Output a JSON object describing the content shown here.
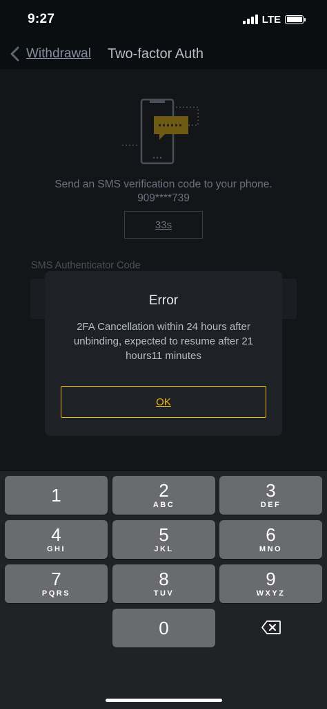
{
  "status_bar": {
    "time": "9:27",
    "network": "LTE"
  },
  "nav": {
    "back_label": "Withdrawal",
    "title": "Two-factor Auth"
  },
  "page": {
    "sms_description": "Send an SMS verification code to your phone.",
    "phone_masked": "909****739",
    "countdown_label": "33s",
    "code_label": "SMS Authenticator Code"
  },
  "dialog": {
    "title": "Error",
    "message": "2FA Cancellation within 24 hours after unbinding, expected to resume after 21 hours11 minutes",
    "ok_label": "OK"
  },
  "keypad": {
    "keys": [
      {
        "num": "1",
        "letters": ""
      },
      {
        "num": "2",
        "letters": "ABC"
      },
      {
        "num": "3",
        "letters": "DEF"
      },
      {
        "num": "4",
        "letters": "GHI"
      },
      {
        "num": "5",
        "letters": "JKL"
      },
      {
        "num": "6",
        "letters": "MNO"
      },
      {
        "num": "7",
        "letters": "PQRS"
      },
      {
        "num": "8",
        "letters": "TUV"
      },
      {
        "num": "9",
        "letters": "WXYZ"
      },
      {
        "num": "0",
        "letters": ""
      }
    ],
    "delete_icon": "backspace-icon"
  },
  "colors": {
    "accent": "#f0b90b",
    "background": "#0b0e11",
    "dialog_bg": "#1e2126",
    "key_bg": "#6a6b6e"
  }
}
